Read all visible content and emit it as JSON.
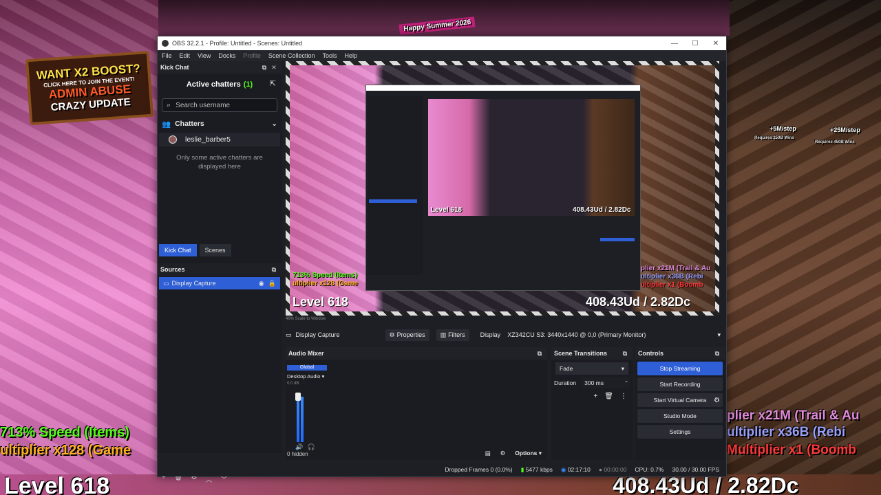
{
  "background": {
    "ad_lines": [
      "WANT X2 BOOST?",
      "CLICK HERE TO JOIN THE EVENT!",
      "ADMIN ABUSE",
      "CRAZY UPDATE"
    ],
    "banner_top": "Happy Summer 2026",
    "left_overlay": [
      "713% Speed (Items)",
      "ultiplier x128 (Game"
    ],
    "level": "Level 618",
    "right_overlay": [
      "plier x21M (Trail & Au",
      "ultiplier x36B (Rebi",
      "Multiplier x1 (Boomb"
    ],
    "score": "408.43Ud / 2.82Dc",
    "step_labels": [
      "+5M/step",
      "Requires 250B Wins",
      "+25M/step",
      "Requires 450B Wins"
    ]
  },
  "window": {
    "title": "OBS 32.2.1 - Profile: Untitled - Scenes: Untitled",
    "controls": [
      "—",
      "☐",
      "✕"
    ]
  },
  "menu": [
    "File",
    "Edit",
    "View",
    "Docks",
    "Profile",
    "Scene Collection",
    "Tools",
    "Help"
  ],
  "kick_chat": {
    "dock_title": "Kick Chat",
    "active_label": "Active chatters",
    "active_count": "(1)",
    "search_placeholder": "Search username",
    "chatters_heading": "Chatters",
    "chatter": "leslie_barber5",
    "note": "Only some active chatters are displayed here"
  },
  "dock_tabs": [
    "Kick Chat",
    "Scenes"
  ],
  "sources": {
    "title": "Sources",
    "items": [
      {
        "name": "Display Capture"
      }
    ]
  },
  "preview": {
    "level": "Level 618",
    "score": "408.43Ud / 2.82Dc",
    "nested_level": "Level 618",
    "nested_score": "408.43Ud / 2.82Dc",
    "overlay_left": [
      "713% Speed (Items)",
      "ultiplier x128 (Game"
    ],
    "overlay_right": [
      "plier x21M (Trail & Au",
      "ultiplier x36B (Rebi",
      "ultiplier x1 (Boomb"
    ]
  },
  "scale_row": "49%    Scale to Window",
  "source_toolbar": {
    "source_name": "Display Capture",
    "properties": "Properties",
    "filters": "Filters",
    "display_label": "Display",
    "display_value": "XZ342CU S3: 3440x1440 @ 0,0 (Primary Monitor)"
  },
  "audio_mixer": {
    "title": "Audio Mixer",
    "global": "Global",
    "channel": "Desktop Audio",
    "db": "0.0 dB",
    "hidden": "0 hidden",
    "options": "Options"
  },
  "scene_transitions": {
    "title": "Scene Transitions",
    "transition": "Fade",
    "duration_label": "Duration",
    "duration_value": "300 ms"
  },
  "controls": {
    "title": "Controls",
    "buttons": [
      "Stop Streaming",
      "Start Recording",
      "Start Virtual Camera",
      "Studio Mode",
      "Settings"
    ]
  },
  "status": {
    "dropped": "Dropped Frames 0 (0.0%)",
    "kbps": "5477 kbps",
    "stream_time": "02:17:10",
    "rec_time": "00:00:00",
    "cpu": "CPU: 0.7%",
    "fps": "30.00 / 30.00 FPS"
  },
  "colors": {
    "accent": "#2e5fd6",
    "kick_green": "#53fc18",
    "panel": "#1b1c21"
  }
}
